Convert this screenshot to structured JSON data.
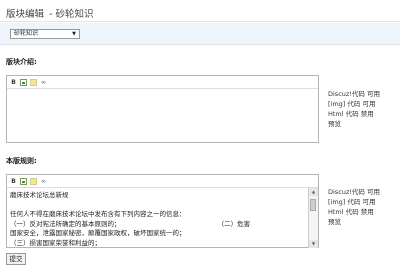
{
  "header": {
    "title": "版块编辑",
    "subtitle": "- 砂轮知识"
  },
  "forum_select": {
    "value": "砂轮知识"
  },
  "intro": {
    "label": "版块介绍:",
    "toolbar": [
      "bold-icon",
      "image-icon",
      "highlight-icon",
      "link-icon"
    ],
    "side": [
      "Discuz!代码 可用",
      "[img] 代码 可用",
      "Html 代码 禁用",
      "预览"
    ]
  },
  "rules": {
    "label": "本版规则:",
    "side": [
      "Discuz!代码 可用",
      "[img] 代码 可用",
      "Html 代码 禁用",
      "预览"
    ],
    "lines": [
      "磨床技术论坛总新规",
      "",
      "任何人不得在磨床技术论坛中发布含有下列内容之一的信息：",
      "（一）反对宪法所确定的基本原则的；                                               （二）危害",
      "国家安全，泄露国家秘密，颠覆国家政权，破坏国家统一的；",
      "（三）损害国家荣誉和利益的；"
    ]
  },
  "submit_label": "提交"
}
